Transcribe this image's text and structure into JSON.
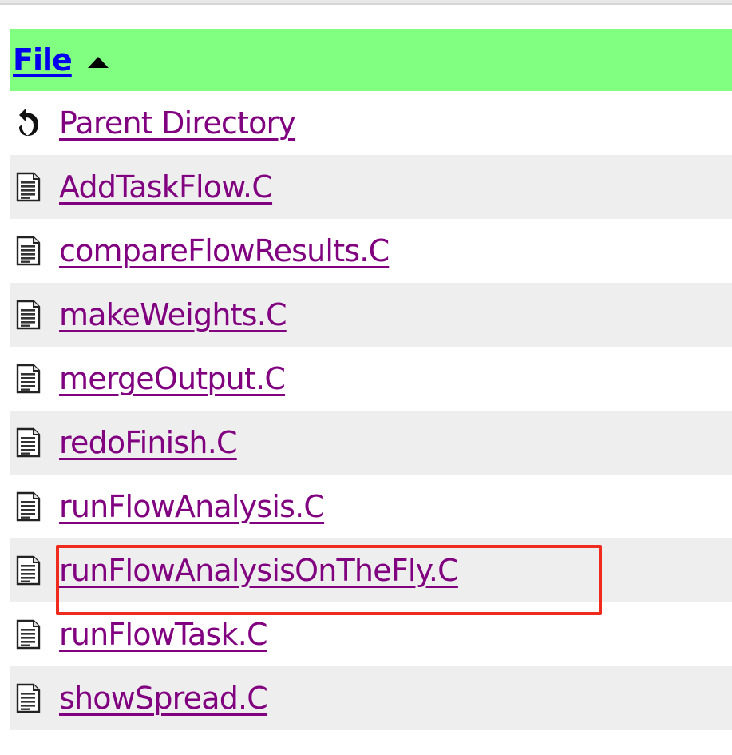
{
  "table": {
    "header": {
      "label": "File",
      "sort_icon": "sort-ascending-icon"
    },
    "rows": [
      {
        "label": "Parent Directory",
        "icon": "back-arrow-icon"
      },
      {
        "label": "AddTaskFlow.C",
        "icon": "text-file-icon"
      },
      {
        "label": "compareFlowResults.C",
        "icon": "text-file-icon"
      },
      {
        "label": "makeWeights.C",
        "icon": "text-file-icon"
      },
      {
        "label": "mergeOutput.C",
        "icon": "text-file-icon"
      },
      {
        "label": "redoFinish.C",
        "icon": "text-file-icon"
      },
      {
        "label": "runFlowAnalysis.C",
        "icon": "text-file-icon"
      },
      {
        "label": "runFlowAnalysisOnTheFly.C",
        "icon": "text-file-icon"
      },
      {
        "label": "runFlowTask.C",
        "icon": "text-file-icon"
      },
      {
        "label": "showSpread.C",
        "icon": "text-file-icon"
      }
    ]
  },
  "highlight": {
    "target": "runFlowAnalysisOnTheFly.C",
    "color": "#ef2b1e"
  },
  "colors": {
    "header_bg": "#80ff80",
    "header_link": "#0000ee",
    "visited_link": "#800080",
    "alt_row_bg": "#eeeeee"
  }
}
